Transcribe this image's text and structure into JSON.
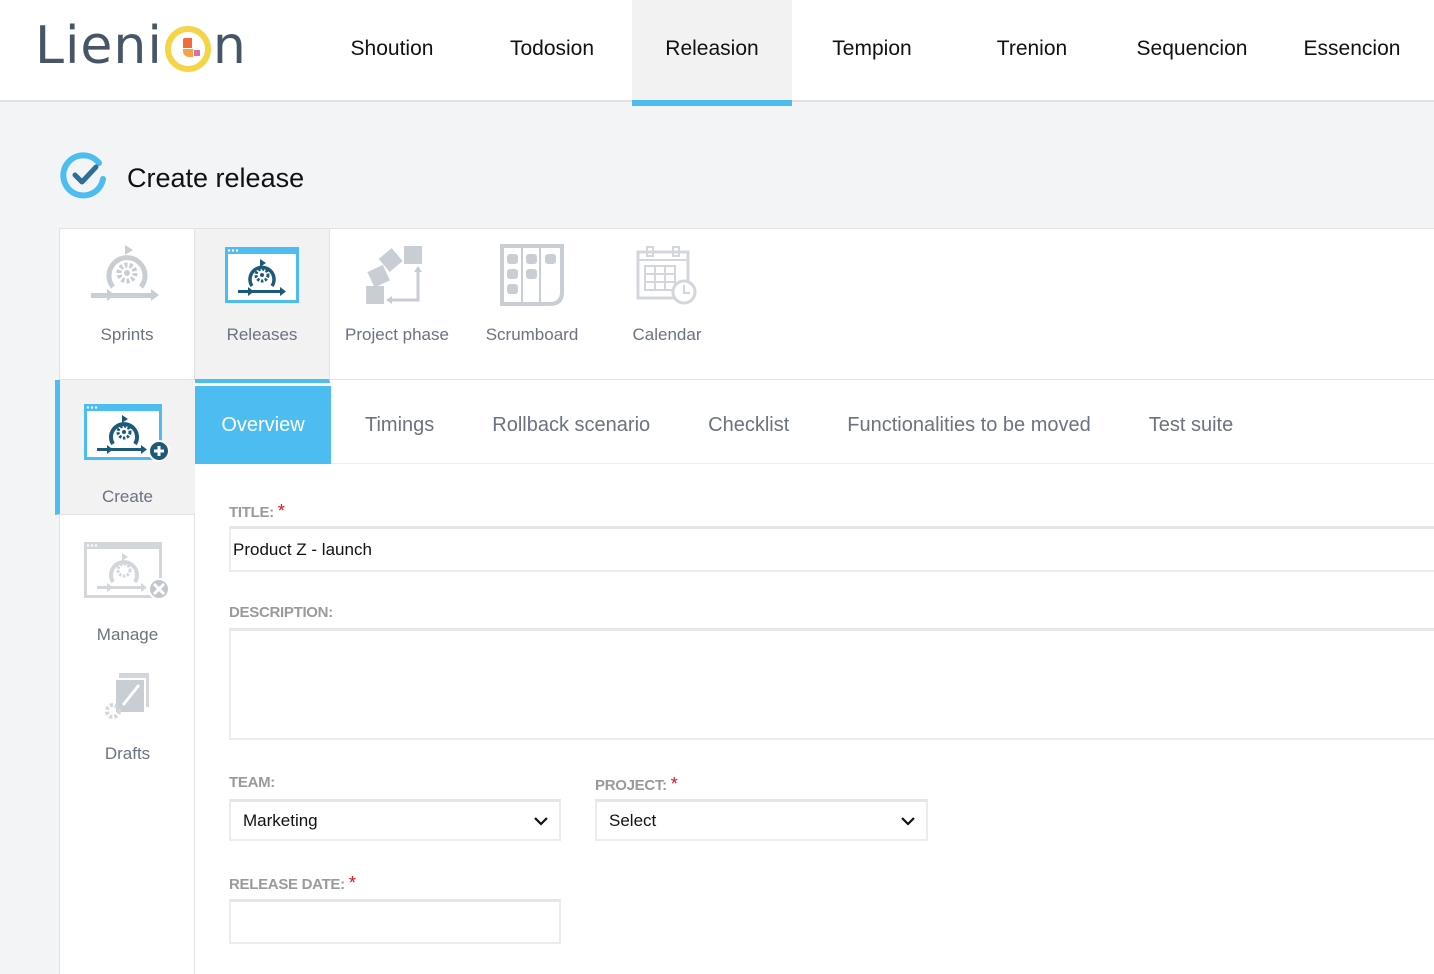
{
  "brand": {
    "logo_text_left": "Lieni",
    "logo_text_right": "n",
    "accent": "#4dbcf1"
  },
  "topnav": {
    "items": [
      {
        "label": "Shoution",
        "active": false
      },
      {
        "label": "Todosion",
        "active": false
      },
      {
        "label": "Releasion",
        "active": true
      },
      {
        "label": "Tempion",
        "active": false
      },
      {
        "label": "Trenion",
        "active": false
      },
      {
        "label": "Sequencion",
        "active": false
      },
      {
        "label": "Essencion",
        "active": false
      }
    ]
  },
  "page": {
    "title": "Create release",
    "title_icon": "check-circle-icon"
  },
  "modules": [
    {
      "label": "Sprints",
      "icon": "sprint-cycle-icon",
      "active": false
    },
    {
      "label": "Releases",
      "icon": "release-window-icon",
      "active": true
    },
    {
      "label": "Project phase",
      "icon": "project-phase-icon",
      "active": false
    },
    {
      "label": "Scrumboard",
      "icon": "scrumboard-icon",
      "active": false
    },
    {
      "label": "Calendar",
      "icon": "calendar-clock-icon",
      "active": false
    }
  ],
  "subnav": [
    {
      "label": "Create",
      "icon": "create-release-icon",
      "active": true
    },
    {
      "label": "Manage",
      "icon": "manage-release-icon",
      "active": false
    },
    {
      "label": "Drafts",
      "icon": "drafts-icon",
      "active": false
    }
  ],
  "tabs": [
    {
      "label": "Overview",
      "active": true
    },
    {
      "label": "Timings",
      "active": false
    },
    {
      "label": "Rollback scenario",
      "active": false
    },
    {
      "label": "Checklist",
      "active": false
    },
    {
      "label": "Functionalities to be moved",
      "active": false
    },
    {
      "label": "Test suite",
      "active": false
    }
  ],
  "form": {
    "title": {
      "label": "TITLE:",
      "required_mark": "*",
      "value": "Product Z - launch"
    },
    "description": {
      "label": "DESCRIPTION:",
      "value": ""
    },
    "team": {
      "label": "TEAM:",
      "value": "Marketing"
    },
    "project": {
      "label": "PROJECT:",
      "required_mark": "*",
      "value": "Select"
    },
    "release_date": {
      "label": "RELEASE DATE:",
      "required_mark": "*",
      "value": ""
    }
  }
}
